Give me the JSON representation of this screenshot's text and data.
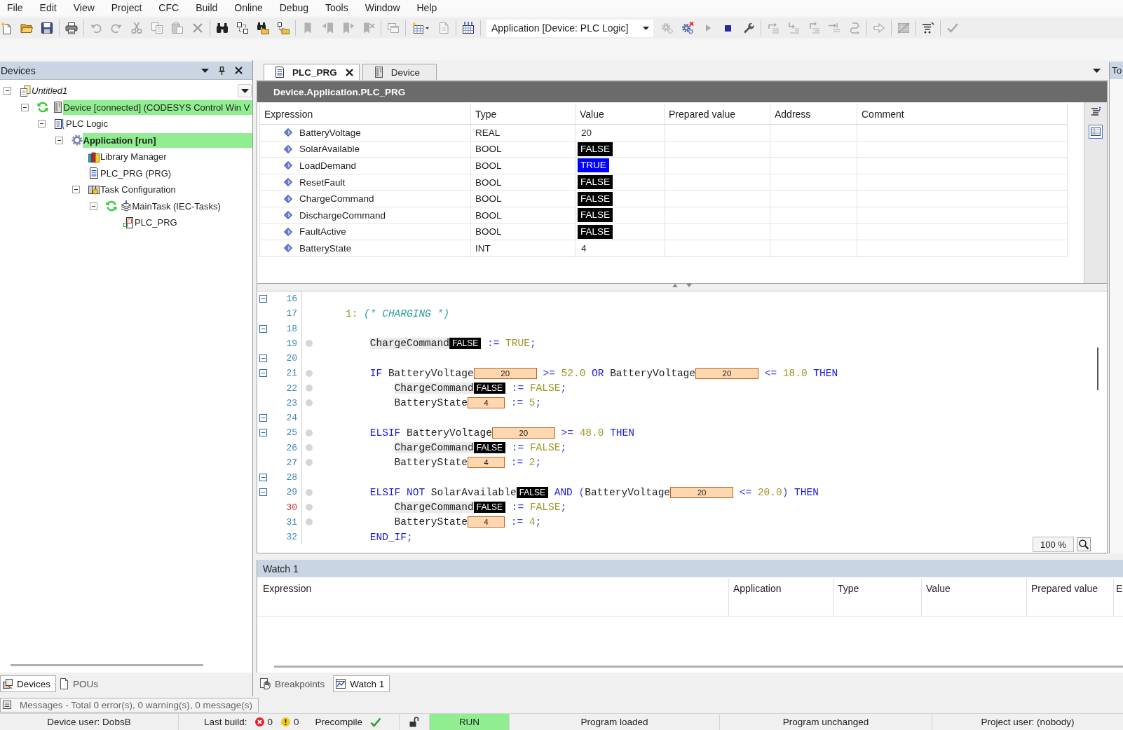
{
  "menu": [
    "File",
    "Edit",
    "View",
    "Project",
    "CFC",
    "Build",
    "Online",
    "Debug",
    "Tools",
    "Window",
    "Help"
  ],
  "toolbar": {
    "left": [
      [
        {
          "kind": "new",
          "disabled": false
        },
        {
          "kind": "open",
          "disabled": false
        },
        {
          "kind": "save",
          "disabled": false
        }
      ],
      [
        {
          "kind": "print",
          "disabled": false
        }
      ],
      [
        {
          "kind": "undo",
          "disabled": true
        },
        {
          "kind": "redo",
          "disabled": true
        },
        {
          "kind": "cut",
          "disabled": true
        },
        {
          "kind": "copy",
          "disabled": true
        },
        {
          "kind": "paste",
          "disabled": true
        },
        {
          "kind": "delete",
          "disabled": true
        }
      ],
      [
        {
          "kind": "find",
          "disabled": false
        },
        {
          "kind": "replace",
          "disabled": false
        },
        {
          "kind": "findall",
          "disabled": false
        },
        {
          "kind": "replaceall",
          "disabled": false
        }
      ],
      [
        {
          "kind": "bookmark",
          "disabled": true
        },
        {
          "kind": "bookprev",
          "disabled": true
        },
        {
          "kind": "booknext",
          "disabled": true
        },
        {
          "kind": "bookclear",
          "disabled": true
        }
      ],
      [
        {
          "kind": "windows",
          "disabled": true
        }
      ],
      [
        {
          "kind": "addobject",
          "disabled": false
        },
        {
          "kind": "document",
          "disabled": true
        }
      ],
      [
        {
          "kind": "build",
          "disabled": false
        }
      ]
    ],
    "selector": "Application [Device: PLC Logic]",
    "right": [
      [
        {
          "kind": "login",
          "disabled": true
        },
        {
          "kind": "logout",
          "disabled": false
        },
        {
          "kind": "start",
          "disabled": true
        },
        {
          "kind": "stop",
          "disabled": false
        },
        {
          "kind": "reset",
          "disabled": false
        }
      ],
      [
        {
          "kind": "stepover",
          "disabled": true
        },
        {
          "kind": "stepinto",
          "disabled": true
        },
        {
          "kind": "stepout",
          "disabled": true
        },
        {
          "kind": "runtocursor",
          "disabled": true
        },
        {
          "kind": "setnext",
          "disabled": true
        }
      ],
      [
        {
          "kind": "shownext",
          "disabled": true
        }
      ],
      [
        {
          "kind": "grid",
          "disabled": true
        }
      ],
      [
        {
          "kind": "write",
          "disabled": false
        }
      ],
      [
        {
          "kind": "check",
          "disabled": true
        }
      ]
    ]
  },
  "devices_panel": {
    "title": "Devices",
    "tree": [
      {
        "label": "Untitled1",
        "kind": "project",
        "expanded": true,
        "highlighted": false,
        "active": false,
        "online": false,
        "children": [
          {
            "label": "Device [connected] (CODESYS Control Win V",
            "kind": "device",
            "expanded": true,
            "highlighted": true,
            "active": false,
            "online": true,
            "children": [
              {
                "label": "PLC Logic",
                "kind": "plc",
                "expanded": true,
                "highlighted": false,
                "active": false,
                "online": false,
                "children": [
                  {
                    "label": "Application [run]",
                    "kind": "application",
                    "expanded": true,
                    "highlighted": true,
                    "active": true,
                    "online": false,
                    "children": [
                      {
                        "label": "Library Manager",
                        "kind": "library",
                        "highlighted": false,
                        "active": false,
                        "online": false
                      },
                      {
                        "label": "PLC_PRG (PRG)",
                        "kind": "pou",
                        "highlighted": false,
                        "active": false,
                        "online": false
                      },
                      {
                        "label": "Task Configuration",
                        "kind": "tasks",
                        "expanded": true,
                        "highlighted": false,
                        "active": false,
                        "online": false,
                        "children": [
                          {
                            "label": "MainTask (IEC-Tasks)",
                            "kind": "task",
                            "expanded": true,
                            "highlighted": false,
                            "active": false,
                            "online": true,
                            "children": [
                              {
                                "label": "PLC_PRG",
                                "kind": "call",
                                "highlighted": false,
                                "active": false,
                                "online": false
                              }
                            ]
                          }
                        ]
                      }
                    ]
                  }
                ]
              }
            ]
          }
        ]
      }
    ],
    "tabs": [
      {
        "label": "Devices",
        "kind": "devices",
        "selected": true
      },
      {
        "label": "POUs",
        "kind": "pous",
        "selected": false
      }
    ]
  },
  "editor": {
    "tabs": [
      {
        "label": "PLC_PRG",
        "kind": "pou",
        "selected": true,
        "closable": true
      },
      {
        "label": "Device",
        "kind": "device",
        "selected": false,
        "closable": false
      }
    ],
    "path": "Device.Application.PLC_PRG",
    "columns": [
      "Expression",
      "Type",
      "Value",
      "Prepared value",
      "Address",
      "Comment"
    ],
    "rows": [
      {
        "expression": "BatteryVoltage",
        "type": "REAL",
        "value": "20",
        "kind": "plain"
      },
      {
        "expression": "SolarAvailable",
        "type": "BOOL",
        "value": "FALSE",
        "kind": "bool",
        "on": false
      },
      {
        "expression": "LoadDemand",
        "type": "BOOL",
        "value": "TRUE",
        "kind": "bool",
        "on": true
      },
      {
        "expression": "ResetFault",
        "type": "BOOL",
        "value": "FALSE",
        "kind": "bool",
        "on": false
      },
      {
        "expression": "ChargeCommand",
        "type": "BOOL",
        "value": "FALSE",
        "kind": "bool",
        "on": false
      },
      {
        "expression": "DischargeCommand",
        "type": "BOOL",
        "value": "FALSE",
        "kind": "bool",
        "on": false
      },
      {
        "expression": "FaultActive",
        "type": "BOOL",
        "value": "FALSE",
        "kind": "bool",
        "on": false
      },
      {
        "expression": "BatteryState",
        "type": "INT",
        "value": "4",
        "kind": "plain"
      }
    ],
    "views": [
      {
        "kind": "text",
        "selected": false
      },
      {
        "kind": "table",
        "selected": true
      }
    ],
    "code": [
      {
        "number": "16",
        "fold": true,
        "dot": false,
        "flagged": false
      },
      {
        "number": "17",
        "fold": false,
        "dot": false,
        "flagged": false,
        "tokens": [
          {
            "kind": "num",
            "text": "1:"
          },
          {
            "kind": "comment",
            "text": " (* CHARGING *)"
          }
        ],
        "children": [
          {
            "number": "18",
            "fold": true,
            "dot": false,
            "flagged": false
          },
          {
            "number": "19",
            "fold": false,
            "dot": true,
            "flagged": false,
            "tokens": [
              {
                "kind": "match",
                "text": "ChargeCommand"
              },
              {
                "kind": "bool",
                "text": "FALSE",
                "on": false
              },
              {
                "kind": "op",
                "text": " :="
              },
              {
                "kind": "num",
                "text": " TRUE"
              },
              {
                "kind": "op",
                "text": ";"
              }
            ]
          },
          {
            "number": "20",
            "fold": true,
            "dot": false,
            "flagged": false
          },
          {
            "number": "21",
            "fold": true,
            "dot": true,
            "flagged": false,
            "tokens": [
              {
                "kind": "kw",
                "text": "IF"
              },
              {
                "kind": "id",
                "text": " BatteryVoltage"
              },
              {
                "kind": "real",
                "text": "20"
              },
              {
                "kind": "op",
                "text": " >="
              },
              {
                "kind": "num",
                "text": " 52.0"
              },
              {
                "kind": "kw",
                "text": " OR"
              },
              {
                "kind": "id",
                "text": " BatteryVoltage"
              },
              {
                "kind": "real",
                "text": "20"
              },
              {
                "kind": "op",
                "text": " <="
              },
              {
                "kind": "num",
                "text": " 18.0"
              },
              {
                "kind": "kw",
                "text": " THEN"
              }
            ],
            "children": [
              {
                "number": "22",
                "fold": false,
                "dot": true,
                "flagged": false,
                "tokens": [
                  {
                    "kind": "match",
                    "text": "ChargeCommand"
                  },
                  {
                    "kind": "bool",
                    "text": "FALSE",
                    "on": false
                  },
                  {
                    "kind": "op",
                    "text": " :="
                  },
                  {
                    "kind": "num",
                    "text": " FALSE"
                  },
                  {
                    "kind": "op",
                    "text": ";"
                  }
                ]
              },
              {
                "number": "23",
                "fold": false,
                "dot": true,
                "flagged": false,
                "tokens": [
                  {
                    "kind": "id",
                    "text": "BatteryState"
                  },
                  {
                    "kind": "int",
                    "text": "4"
                  },
                  {
                    "kind": "op",
                    "text": " :="
                  },
                  {
                    "kind": "num",
                    "text": " 5"
                  },
                  {
                    "kind": "op",
                    "text": ";"
                  }
                ]
              }
            ]
          },
          {
            "number": "24",
            "fold": true,
            "dot": false,
            "flagged": false
          },
          {
            "number": "25",
            "fold": true,
            "dot": true,
            "flagged": false,
            "tokens": [
              {
                "kind": "kw",
                "text": "ELSIF"
              },
              {
                "kind": "id",
                "text": " BatteryVoltage"
              },
              {
                "kind": "real",
                "text": "20"
              },
              {
                "kind": "op",
                "text": " >="
              },
              {
                "kind": "num",
                "text": " 48.0"
              },
              {
                "kind": "kw",
                "text": " THEN"
              }
            ],
            "children": [
              {
                "number": "26",
                "fold": false,
                "dot": true,
                "flagged": false,
                "tokens": [
                  {
                    "kind": "match",
                    "text": "ChargeCommand"
                  },
                  {
                    "kind": "bool",
                    "text": "FALSE",
                    "on": false
                  },
                  {
                    "kind": "op",
                    "text": " :="
                  },
                  {
                    "kind": "num",
                    "text": " FALSE"
                  },
                  {
                    "kind": "op",
                    "text": ";"
                  }
                ]
              },
              {
                "number": "27",
                "fold": false,
                "dot": true,
                "flagged": false,
                "tokens": [
                  {
                    "kind": "id",
                    "text": "BatteryState"
                  },
                  {
                    "kind": "int",
                    "text": "4"
                  },
                  {
                    "kind": "op",
                    "text": " :="
                  },
                  {
                    "kind": "num",
                    "text": " 2"
                  },
                  {
                    "kind": "op",
                    "text": ";"
                  }
                ]
              }
            ]
          },
          {
            "number": "28",
            "fold": true,
            "dot": false,
            "flagged": false
          },
          {
            "number": "29",
            "fold": true,
            "dot": true,
            "flagged": false,
            "tokens": [
              {
                "kind": "kw",
                "text": "ELSIF"
              },
              {
                "kind": "kw",
                "text": " NOT"
              },
              {
                "kind": "id",
                "text": " SolarAvailable"
              },
              {
                "kind": "bool",
                "text": "FALSE",
                "on": false
              },
              {
                "kind": "kw",
                "text": " AND"
              },
              {
                "kind": "op",
                "text": " ("
              },
              {
                "kind": "id",
                "text": "BatteryVoltage"
              },
              {
                "kind": "real",
                "text": "20"
              },
              {
                "kind": "op",
                "text": " <="
              },
              {
                "kind": "num",
                "text": " 20.0"
              },
              {
                "kind": "op",
                "text": ")"
              },
              {
                "kind": "kw",
                "text": " THEN"
              }
            ],
            "children": [
              {
                "number": "30",
                "fold": false,
                "dot": true,
                "flagged": true,
                "tokens": [
                  {
                    "kind": "match",
                    "text": "ChargeCommand"
                  },
                  {
                    "kind": "bool",
                    "text": "FALSE",
                    "on": false
                  },
                  {
                    "kind": "op",
                    "text": " :="
                  },
                  {
                    "kind": "num",
                    "text": " FALSE"
                  },
                  {
                    "kind": "op",
                    "text": ";"
                  }
                ]
              },
              {
                "number": "31",
                "fold": false,
                "dot": true,
                "flagged": false,
                "tokens": [
                  {
                    "kind": "id",
                    "text": "BatteryState"
                  },
                  {
                    "kind": "int",
                    "text": "4"
                  },
                  {
                    "kind": "op",
                    "text": " :="
                  },
                  {
                    "kind": "num",
                    "text": " 4"
                  },
                  {
                    "kind": "op",
                    "text": ";"
                  }
                ]
              }
            ]
          },
          {
            "number": "32",
            "fold": false,
            "dot": false,
            "flagged": false,
            "tokens": [
              {
                "kind": "kw",
                "text": "END_IF"
              },
              {
                "kind": "op",
                "text": ";"
              }
            ]
          }
        ]
      }
    ],
    "zoom": "100 %"
  },
  "side_panel": {
    "title": "To"
  },
  "watch": {
    "title": "Watch 1",
    "columns": [
      "Expression",
      "Application",
      "Type",
      "Value",
      "Prepared value",
      "E"
    ]
  },
  "dock_tabs": [
    {
      "label": "Breakpoints",
      "kind": "breakpoints",
      "selected": false
    },
    {
      "label": "Watch 1",
      "kind": "watch",
      "selected": true
    }
  ],
  "messages": "Messages - Total 0 error(s), 0 warning(s), 0 message(s)",
  "status_bar": {
    "device_user": "Device user: DobsB",
    "last_build": "Last build:",
    "errors": "0",
    "warnings": "0",
    "precompile": "Precompile",
    "precompile_ok": true,
    "locked": false,
    "state": "RUN",
    "running": true,
    "program": "Program loaded",
    "changes": "Program unchanged",
    "project_user": "Project user: (nobody)"
  }
}
